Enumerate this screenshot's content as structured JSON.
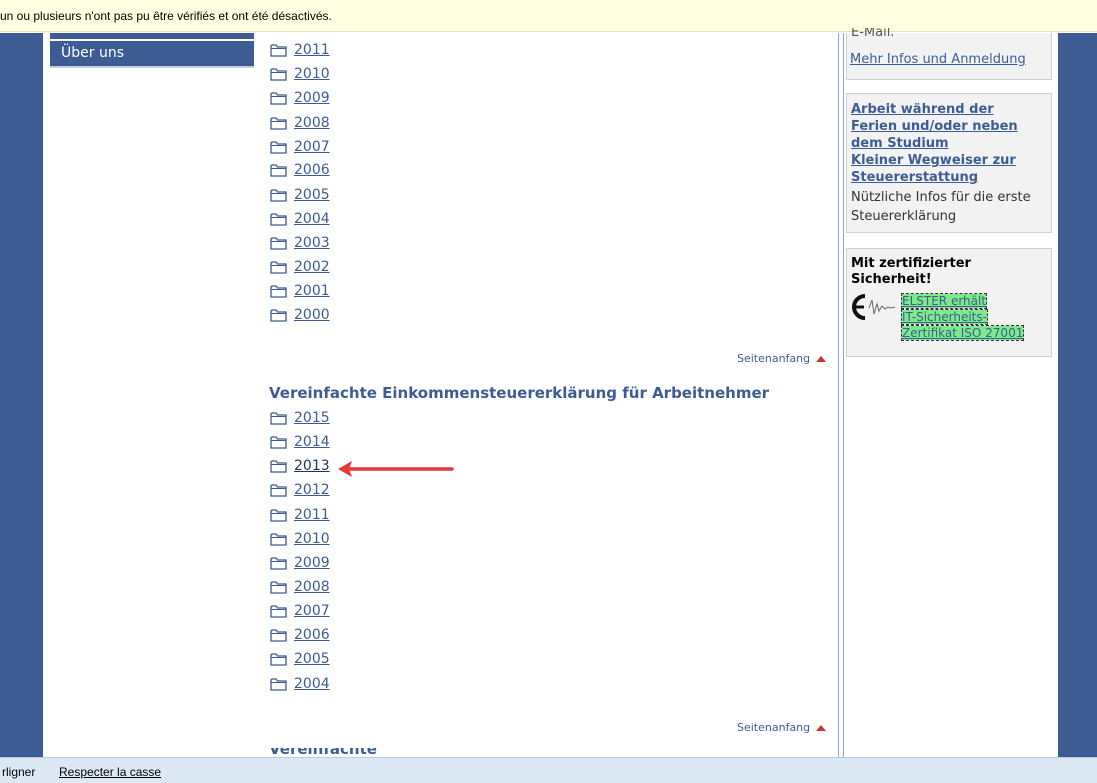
{
  "infobar": {
    "message": "un ou plusieurs n'ont pas pu être vérifiés et ont été désactivés."
  },
  "nav": {
    "item_label": "Über uns"
  },
  "list1": {
    "years": [
      "2011",
      "2010",
      "2009",
      "2008",
      "2007",
      "2006",
      "2005",
      "2004",
      "2003",
      "2002",
      "2001",
      "2000"
    ]
  },
  "back_to_top_label": "Seitenanfang",
  "section2": {
    "heading": "Vereinfachte Einkommensteuererklärung für Arbeitnehmer",
    "years": [
      "2015",
      "2014",
      "2013",
      "2012",
      "2011",
      "2010",
      "2009",
      "2008",
      "2007",
      "2006",
      "2005",
      "2004"
    ],
    "highlighted_year": "2013"
  },
  "next_section_heading_fragment": "Vereinfachte",
  "sidebar": {
    "email_fragment": "E-Mail.",
    "more_info_link": "Mehr Infos und Anmeldung",
    "box2": {
      "head_line1": "Arbeit während der",
      "head_line2": "Ferien und/oder neben",
      "head_line3": "dem Studium",
      "head_line4": "Kleiner Wegweiser zur",
      "head_line5": "Steuererstattung",
      "text_line1": "Nützliche Infos für die erste",
      "text_line2": "Steuererklärung"
    },
    "box3": {
      "head_line1": "Mit zertifizierter",
      "head_line2": "Sicherheit!",
      "link_line1": "ELSTER erhält",
      "link_line2": "IT-Sicherheits-",
      "link_line3": "Zertifikat ISO 27001"
    }
  },
  "findbar": {
    "highlight_label": "rligner",
    "match_case_label": "Respecter la casse"
  },
  "colors": {
    "brand_blue": "#3d5c94",
    "link_blue": "#3d5c94",
    "infobar_bg": "#ffffe1",
    "findbar_bg": "#dde8f5",
    "arrow_red": "#e53935",
    "highlight_green": "#7dea8a"
  },
  "icons": {
    "folder": "folder-icon",
    "top_arrow": "triangle-up-icon",
    "annotation_arrow": "red-arrow-annotation",
    "elster_logo": "elster-logo"
  }
}
